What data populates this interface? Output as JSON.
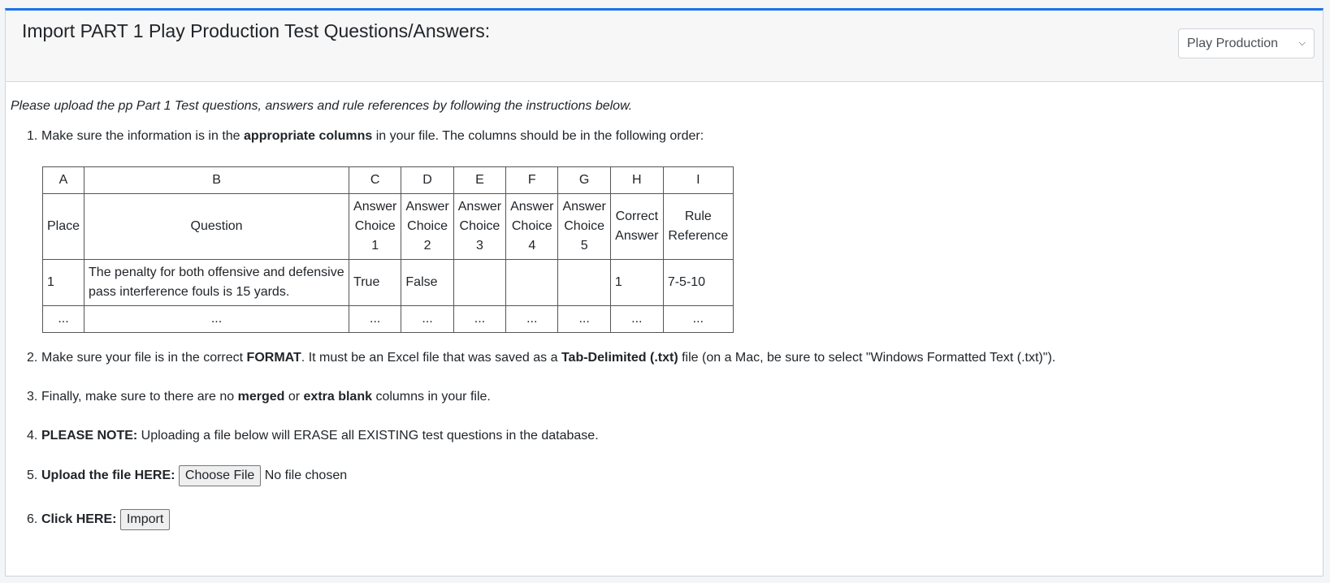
{
  "header": {
    "title": "Import PART 1 Play Production Test Questions/Answers:",
    "select_value": "Play Production"
  },
  "intro": "Please upload the pp Part 1 Test questions, answers and rule references by following the instructions below.",
  "steps": {
    "s1": {
      "num": "1.",
      "pre": "Make sure the information is in the ",
      "bold": "appropriate columns",
      "post": " in your file. The columns should be in the following order:"
    },
    "s2": {
      "num": "2.",
      "pre": "Make sure your file is in the correct ",
      "bold1": "FORMAT",
      "mid": ". It must be an Excel file that was saved as a ",
      "bold2": "Tab-Delimited (.txt)",
      "post": " file (on a Mac, be sure to select \"Windows Formatted Text (.txt)\")."
    },
    "s3": {
      "num": "3.",
      "pre": "Finally, make sure to there are no ",
      "bold1": "merged",
      "mid": " or ",
      "bold2": "extra blank",
      "post": " columns in your file."
    },
    "s4": {
      "num": "4.",
      "bold": "PLEASE NOTE:",
      "post": " Uploading a file below will ERASE all EXISTING test questions in the database."
    },
    "s5": {
      "num": "5.",
      "bold": "Upload the file HERE:",
      "button": "Choose File",
      "status": "No file chosen"
    },
    "s6": {
      "num": "6.",
      "bold": "Click HERE:",
      "button": "Import"
    }
  },
  "table": {
    "letters": [
      "A",
      "B",
      "C",
      "D",
      "E",
      "F",
      "G",
      "H",
      "I"
    ],
    "headers": {
      "place": "Place",
      "question": "Question",
      "c1": [
        "Answer",
        "Choice",
        "1"
      ],
      "c2": [
        "Answer",
        "Choice",
        "2"
      ],
      "c3": [
        "Answer",
        "Choice",
        "3"
      ],
      "c4": [
        "Answer",
        "Choice",
        "4"
      ],
      "c5": [
        "Answer",
        "Choice",
        "5"
      ],
      "correct": [
        "Correct",
        "Answer"
      ],
      "rule": [
        "Rule",
        "Reference"
      ]
    },
    "example": {
      "place": "1",
      "question": "The penalty for both offensive and defensive pass interference fouls is 15 yards.",
      "c1": "True",
      "c2": "False",
      "c3": "",
      "c4": "",
      "c5": "",
      "correct": "1",
      "rule": "7-5-10"
    },
    "ellipsis": "..."
  }
}
